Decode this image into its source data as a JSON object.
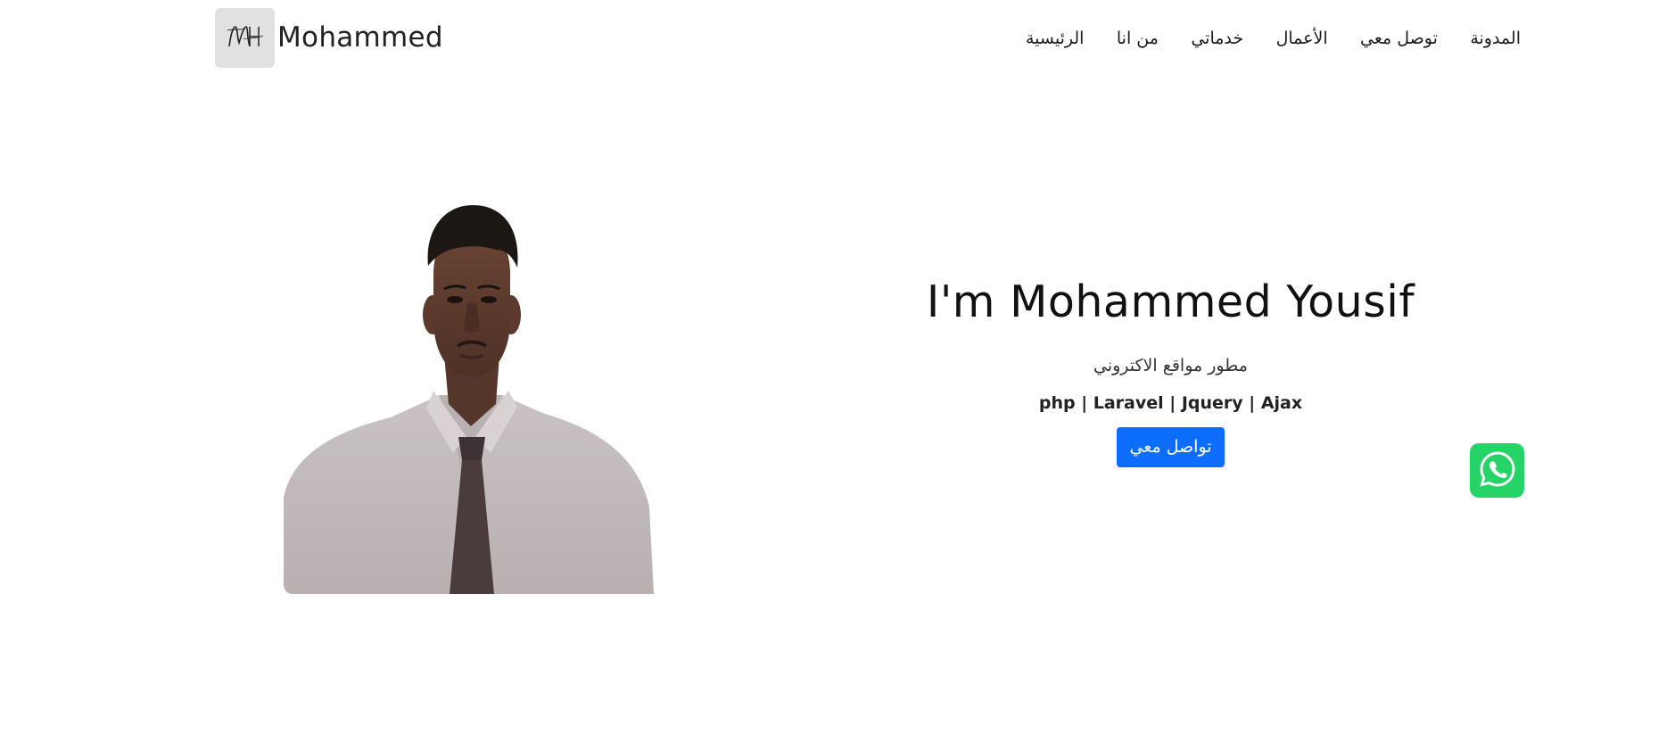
{
  "brand": {
    "name": "Mohammed",
    "logo_icon": "mh-monogram-icon",
    "logo_bg": "#e1e1e1"
  },
  "nav": {
    "items": [
      {
        "label": "الرئيسية"
      },
      {
        "label": "من انا"
      },
      {
        "label": "خدماتي"
      },
      {
        "label": "الأعمال"
      },
      {
        "label": "توصل معي"
      },
      {
        "label": "المدونة"
      }
    ]
  },
  "hero": {
    "title": "I'm Mohammed Yousif",
    "subtitle": "مطور مواقع الاكتروني",
    "skills": "php | Laravel | Jquery | Ajax",
    "cta_label": "تواصل معي",
    "cta_color": "#0d6efd"
  },
  "whatsapp": {
    "icon": "whatsapp-icon",
    "color": "#25d366"
  }
}
